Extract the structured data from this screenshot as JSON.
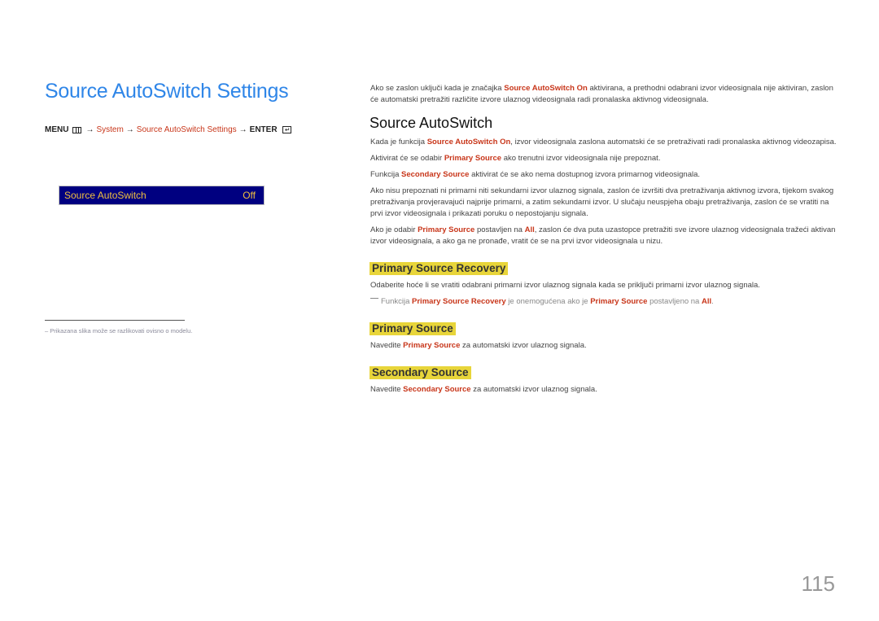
{
  "left": {
    "title": "Source AutoSwitch Settings",
    "breadcrumb": {
      "menu": "MENU",
      "menu_icon": "menu-icon",
      "arrow": "→",
      "system": "System",
      "settings": "Source AutoSwitch Settings",
      "enter": "ENTER",
      "enter_icon": "enter-icon",
      "enter_glyph": "↵"
    },
    "osd": {
      "label": "Source AutoSwitch",
      "value": "Off"
    },
    "footnote": {
      "dash": "–",
      "text": "Prikazana slika može se razlikovati ovisno o modelu."
    }
  },
  "right": {
    "intro": {
      "pre": "Ako se zaslon uključi kada je značajka ",
      "hl": "Source AutoSwitch On",
      "post": " aktivirana, a prethodni odabrani izvor videosignala nije aktiviran, zaslon će automatski pretražiti različite izvore ulaznog videosignala radi pronalaska aktivnog videosignala."
    },
    "section_title": "Source AutoSwitch",
    "p1": {
      "pre": "Kada je funkcija ",
      "hl": "Source AutoSwitch On",
      "post": ", izvor videosignala zaslona automatski će se pretraživati radi pronalaska aktivnog videozapisa."
    },
    "p2": {
      "pre": "Aktivirat će se odabir ",
      "hl": "Primary Source",
      "post": " ako trenutni izvor videosignala nije prepoznat."
    },
    "p3": {
      "pre": "Funkcija ",
      "hl": "Secondary Source",
      "post": " aktivirat će se ako nema dostupnog izvora primarnog videosignala."
    },
    "p4": "Ako nisu prepoznati ni primarni niti sekundarni izvor ulaznog signala, zaslon će izvršiti dva pretraživanja aktivnog izvora, tijekom svakog pretraživanja provjeravajući najprije primarni, a zatim sekundarni izvor. U slučaju neuspjeha obaju pretraživanja, zaslon će se vratiti na prvi izvor videosignala i prikazati poruku o nepostojanju signala.",
    "p5": {
      "pre": "Ako je odabir ",
      "hl1": "Primary Source",
      "mid": " postavljen na ",
      "hl2": "All",
      "post": ", zaslon će dva puta uzastopce pretražiti sve izvore ulaznog videosignala tražeći aktivan izvor videosignala, a ako ga ne pronađe, vratit će se na prvi izvor videosignala u nizu."
    },
    "psr": {
      "title": "Primary Source Recovery",
      "text": "Odaberite hoće li se vratiti odabrani primarni izvor ulaznog signala kada se priključi primarni izvor ulaznog signala.",
      "note": {
        "pre": "Funkcija ",
        "hl1": "Primary Source Recovery",
        "mid1": " je onemogućena ako je ",
        "hl2": "Primary Source",
        "mid2": " postavljeno na ",
        "hl3": "All",
        "post": "."
      }
    },
    "ps": {
      "title": "Primary Source",
      "pre": "Navedite ",
      "hl": "Primary Source",
      "post": " za automatski izvor ulaznog signala."
    },
    "ss": {
      "title": "Secondary Source",
      "pre": "Navedite ",
      "hl": "Secondary Source",
      "post": " za automatski izvor ulaznog signala."
    }
  },
  "page_number": "115",
  "colors": {
    "title_blue": "#2f86e8",
    "highlight_red": "#c8361a",
    "heading_yellow": "#e8d53a",
    "osd_bg": "#000080",
    "osd_text": "#f0c040"
  }
}
